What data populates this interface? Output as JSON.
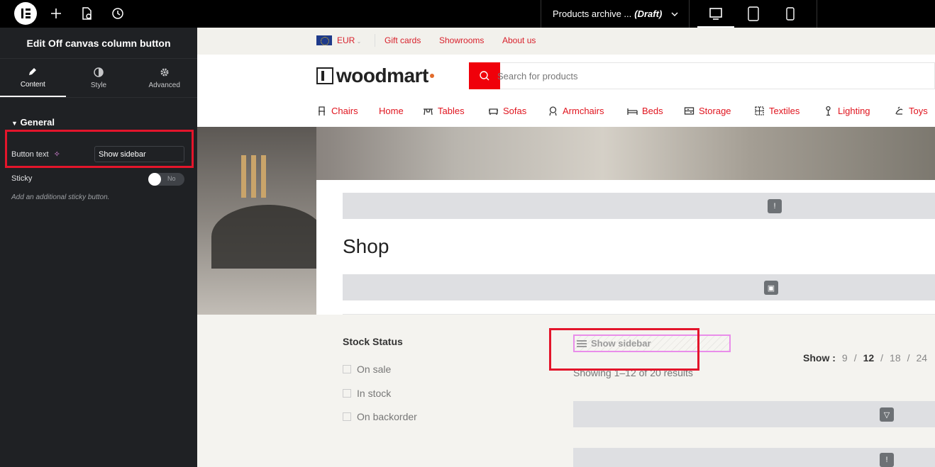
{
  "topbar": {
    "document_title": "Products archive ...",
    "document_status": "(Draft)",
    "devices": [
      "desktop",
      "tablet",
      "mobile"
    ]
  },
  "panel": {
    "title": "Edit Off canvas column button",
    "tabs": [
      {
        "label": "Content",
        "icon": "pencil-icon",
        "active": true
      },
      {
        "label": "Style",
        "icon": "half-circle-icon",
        "active": false
      },
      {
        "label": "Advanced",
        "icon": "gear-icon",
        "active": false
      }
    ],
    "section": "General",
    "button_text_label": "Button text",
    "button_text_value": "Show sidebar",
    "sticky_label": "Sticky",
    "sticky_state": "No",
    "sticky_description": "Add an additional sticky button."
  },
  "site": {
    "currency": "EUR",
    "top_links": [
      "Gift cards",
      "Showrooms",
      "About us"
    ],
    "brand": "woodmart",
    "search_placeholder": "Search for products",
    "nav": [
      {
        "label": "Chairs",
        "icon": "chair-icon"
      },
      {
        "label": "Home",
        "icon": ""
      },
      {
        "label": "Tables",
        "icon": "table-icon"
      },
      {
        "label": "Sofas",
        "icon": "sofa-icon"
      },
      {
        "label": "Armchairs",
        "icon": "armchair-icon"
      },
      {
        "label": "Beds",
        "icon": "bed-icon"
      },
      {
        "label": "Storage",
        "icon": "storage-icon"
      },
      {
        "label": "Textiles",
        "icon": "textiles-icon"
      },
      {
        "label": "Lighting",
        "icon": "lamp-icon"
      },
      {
        "label": "Toys",
        "icon": "toy-icon"
      }
    ],
    "page_title": "Shop",
    "filter_title": "Stock Status",
    "filter_options": [
      "On sale",
      "In stock",
      "On backorder"
    ],
    "sidebar_button": "Show sidebar",
    "results": "Showing 1–12 of 20 results",
    "show_label": "Show :",
    "per_page": [
      "9",
      "12",
      "18",
      "24"
    ],
    "per_page_selected": "12"
  },
  "colors": {
    "accent": "#e0141e",
    "panel_bg": "#1f2124",
    "highlight": "#e3152b"
  }
}
